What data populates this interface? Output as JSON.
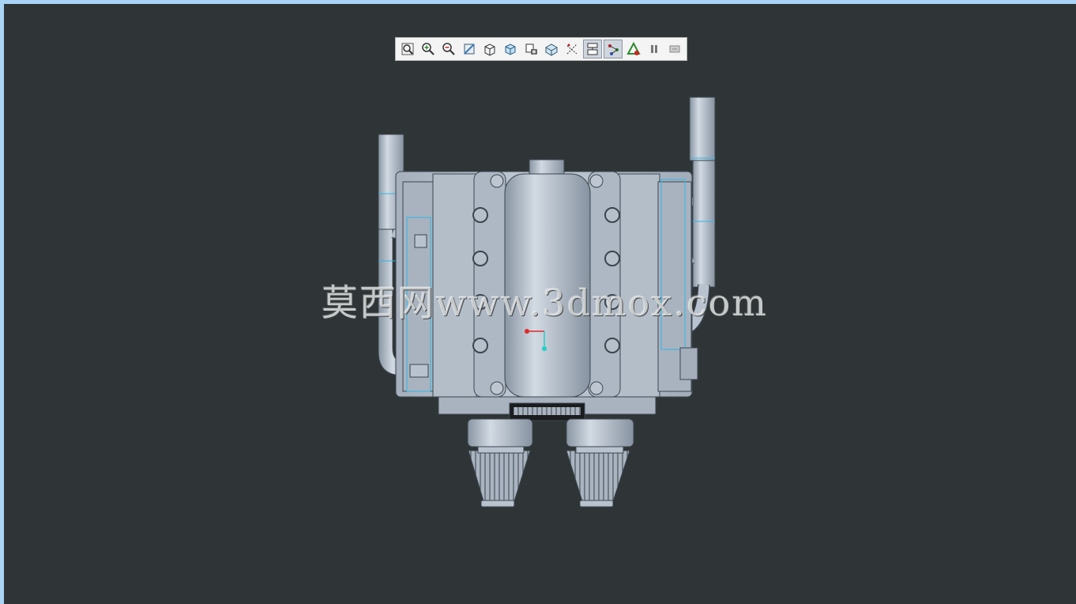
{
  "colors": {
    "window_border": "#aad4f5",
    "viewport_bg": "#2f3536",
    "toolbar_bg": "#f4f4f4",
    "model_fill": "#b9c3cf",
    "model_edge": "#3c4650",
    "highlight_edge": "#2fb7e6"
  },
  "toolbar": {
    "buttons": [
      {
        "icon": "zoom-fit-icon",
        "active": false
      },
      {
        "icon": "zoom-in-icon",
        "active": false
      },
      {
        "icon": "zoom-out-icon",
        "active": false
      },
      {
        "icon": "view-normal-icon",
        "active": false
      },
      {
        "icon": "saved-views-icon",
        "active": false
      },
      {
        "icon": "display-style-icon",
        "active": false
      },
      {
        "icon": "view-manager-icon",
        "active": false
      },
      {
        "icon": "perspective-icon",
        "active": false
      },
      {
        "icon": "datum-display-icon",
        "active": false
      },
      {
        "icon": "annotation-display-icon",
        "active": true
      },
      {
        "icon": "spin-center-icon",
        "active": true
      },
      {
        "icon": "appearance-icon",
        "active": false
      },
      {
        "icon": "pause-icon",
        "active": false
      },
      {
        "icon": "regenerate-icon",
        "active": false
      }
    ]
  },
  "watermark": {
    "text": "莫西网www.3dmox.com"
  }
}
